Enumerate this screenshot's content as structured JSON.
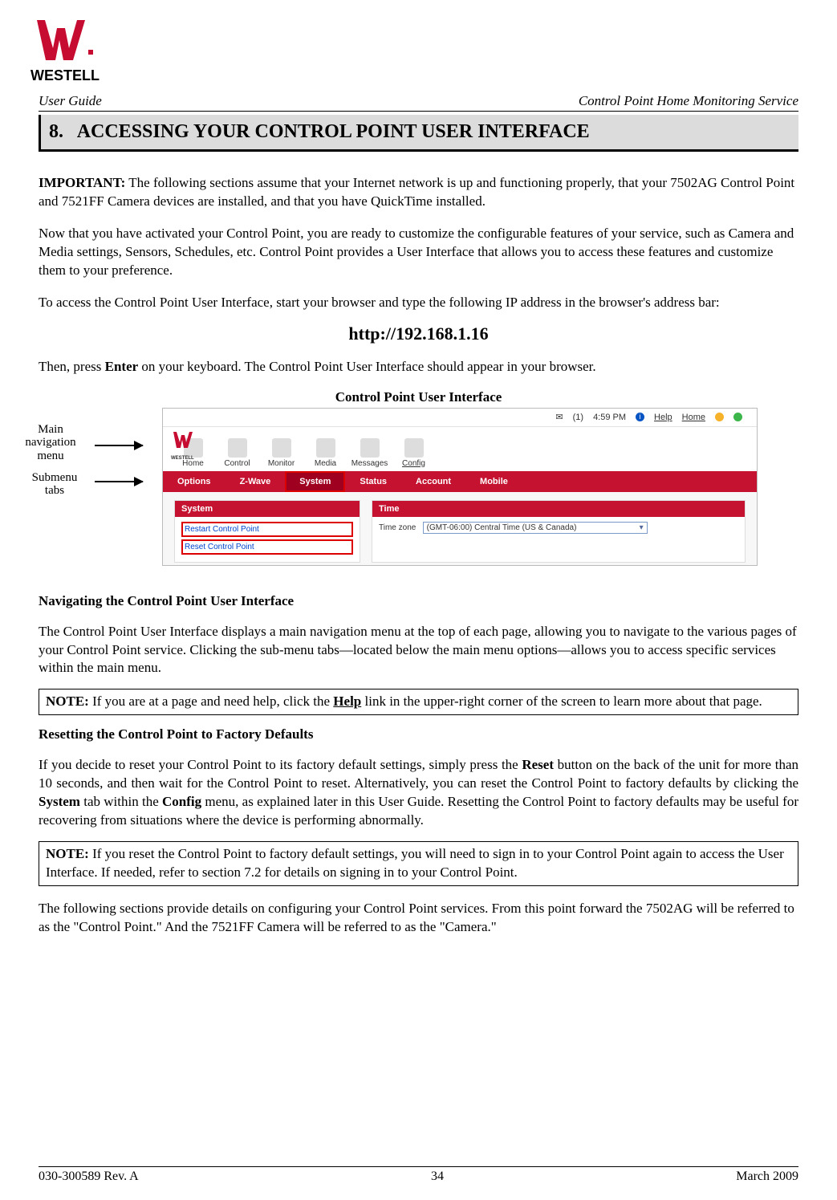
{
  "brand": "WESTELL",
  "header": {
    "left": "User Guide",
    "right": "Control Point Home Monitoring Service"
  },
  "section": {
    "number": "8.",
    "title": "ACCESSING YOUR CONTROL POINT USER INTERFACE"
  },
  "paragraphs": {
    "important_label": "IMPORTANT:",
    "important_body": " The following sections assume that your Internet network is up and functioning properly, that your 7502AG Control Point and 7521FF Camera devices are installed, and that you have QuickTime installed.",
    "p2": "Now that you have activated your Control Point, you are ready to customize the configurable features of your service, such as Camera and Media settings, Sensors, Schedules, etc. Control Point provides a User Interface that allows you to access these features and customize them to your preference.",
    "p3": "To access the Control Point User Interface, start your browser and type the following IP address in the browser's address bar:",
    "url": "http://192.168.1.16",
    "p4a": "Then, press ",
    "p4b_bold": "Enter",
    "p4c": " on your keyboard. The Control Point User Interface should appear in your browser.",
    "caption": "Control Point User Interface"
  },
  "callouts": {
    "main_nav": "Main navigation menu",
    "submenu": "Submenu tabs"
  },
  "screenshot": {
    "topbar": {
      "mail_count": "(1)",
      "time": "4:59 PM",
      "help": "Help",
      "home": "Home"
    },
    "logo": "WESTELL",
    "nav": [
      "Home",
      "Control",
      "Monitor",
      "Media",
      "Messages",
      "Config"
    ],
    "subnav": [
      "Options",
      "Z-Wave",
      "System",
      "Status",
      "Account",
      "Mobile"
    ],
    "subnav_active": "System",
    "panel_system": {
      "title": "System",
      "link1": "Restart Control Point",
      "link2": "Reset Control Point"
    },
    "panel_time": {
      "title": "Time",
      "label": "Time zone",
      "value": "(GMT-06:00) Central Time (US & Canada)"
    }
  },
  "navigating": {
    "heading": "Navigating the Control Point User Interface",
    "body": "The Control Point User Interface displays a main navigation menu at the top of each page, allowing you to navigate to the various pages of your Control Point service. Clicking the sub-menu tabs—located below the main menu options—allows you to access specific services within the main menu."
  },
  "note1": {
    "label": "NOTE:",
    "body_a": " If you are at a page and need help, click the ",
    "help_link": "Help",
    "body_b": " link in the upper-right corner of the screen to learn more about that page."
  },
  "resetting": {
    "heading": "Resetting the Control Point to Factory Defaults",
    "body_a": "If you decide to reset your Control Point to its factory default settings, simply press the ",
    "reset_bold": "Reset",
    "body_b": " button on the back of the unit for more than 10 seconds, and then wait for the Control Point to reset. Alternatively, you can reset the Control Point to factory defaults by clicking the ",
    "system_bold": "System",
    "body_c": " tab within the ",
    "config_bold": "Config",
    "body_d": " menu, as explained later in this User Guide. Resetting the Control Point to factory defaults may be useful for recovering from situations where the device is performing abnormally."
  },
  "note2": {
    "label": "NOTE:",
    "body": " If you reset the Control Point to factory default settings, you will need to sign in to your Control Point again to access the User Interface. If needed, refer to section 7.2  for details on signing in to your Control Point."
  },
  "closing": "The following sections provide details on configuring your Control Point services. From this point forward the 7502AG will be referred to as the \"Control Point.\" And the 7521FF Camera will be referred to as the \"Camera.\"",
  "footer": {
    "left": "030-300589 Rev. A",
    "center": "34",
    "right": "March 2009"
  }
}
